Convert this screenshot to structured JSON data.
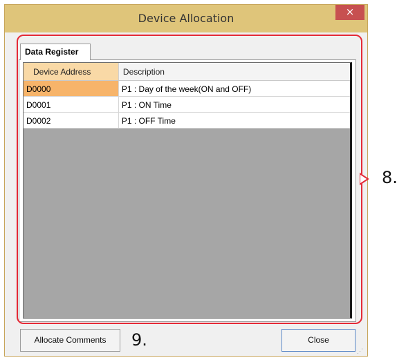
{
  "window": {
    "title": "Device Allocation",
    "close_glyph": "×"
  },
  "tabs": [
    {
      "label": "Data Register",
      "selected": true
    }
  ],
  "table": {
    "columns": [
      "Device Address",
      "Description"
    ],
    "rows": [
      {
        "address": "D0000",
        "description": "P1 : Day of the week(ON and OFF)",
        "selected": true
      },
      {
        "address": "D0001",
        "description": "P1 : ON Time",
        "selected": false
      },
      {
        "address": "D0002",
        "description": "P1 : OFF Time",
        "selected": false
      }
    ]
  },
  "buttons": {
    "allocate_comments": "Allocate Comments",
    "close": "Close"
  },
  "annotations": {
    "label_8": "8.",
    "label_9": "9.",
    "callout_color": "#e52a36"
  },
  "colors": {
    "titlebar": "#dfc57a",
    "close_button": "#c75050",
    "selected_cell": "#f7b46a",
    "grid_empty": "#a6a6a6"
  }
}
